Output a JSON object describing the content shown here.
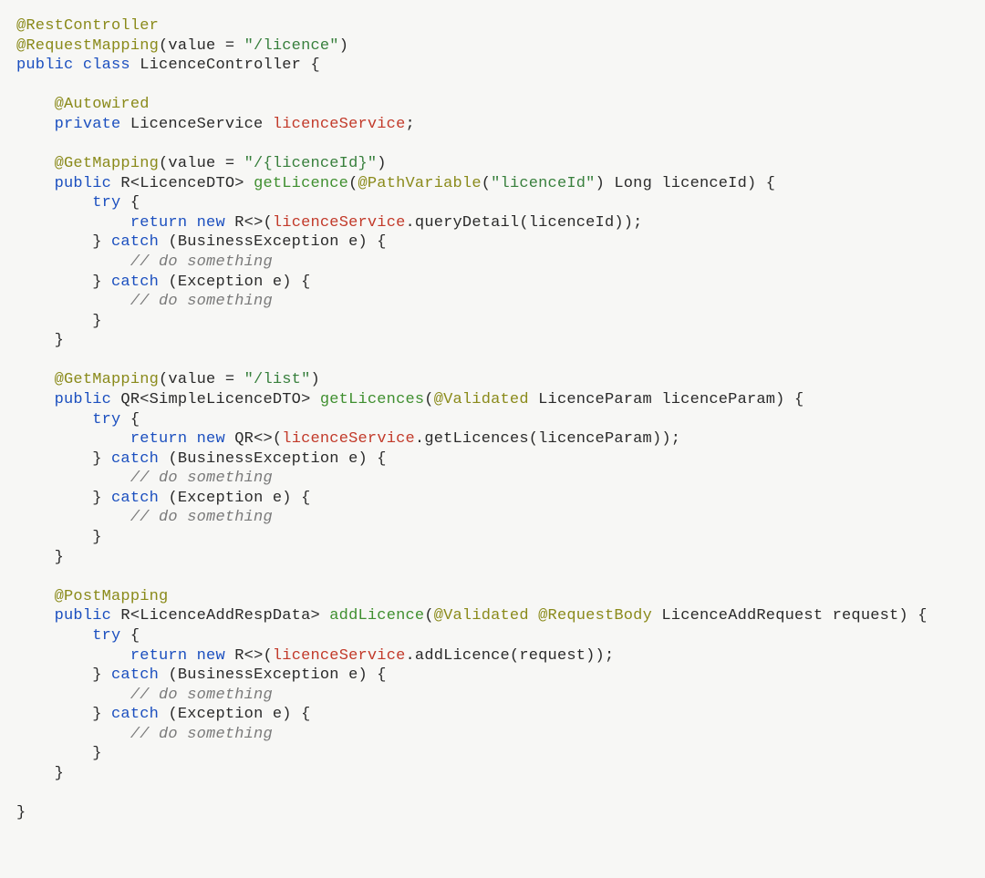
{
  "code": {
    "line01_anno": "@RestController",
    "line02_anno": "@RequestMapping",
    "line02_rest": "(value = ",
    "line02_str": "\"/licence\"",
    "line02_end": ")",
    "line03_kw1": "public",
    "line03_kw2": "class",
    "line03_rest": " LicenceController {",
    "line05_anno": "@Autowired",
    "line06_kw": "private",
    "line06_a": " LicenceService ",
    "line06_field": "licenceService",
    "line06_end": ";",
    "line08_anno": "@GetMapping",
    "line08_a": "(value = ",
    "line08_str": "\"/{licenceId}\"",
    "line08_end": ")",
    "line09_kw": "public",
    "line09_a": " R<LicenceDTO> ",
    "line09_meth": "getLicence",
    "line09_b": "(",
    "line09_anno": "@PathVariable",
    "line09_c": "(",
    "line09_str": "\"licenceId\"",
    "line09_d": ") Long licenceId) {",
    "line10_kw": "try",
    "line10_rest": " {",
    "line11_kw1": "return",
    "line11_kw2": "new",
    "line11_a": " R<>(",
    "line11_field": "licenceService",
    "line11_b": ".queryDetail(licenceId));",
    "line12_a": "} ",
    "line12_kw": "catch",
    "line12_b": " (BusinessException e) {",
    "line13_comm": "// do something",
    "line14_a": "} ",
    "line14_kw": "catch",
    "line14_b": " (Exception e) {",
    "line15_comm": "// do something",
    "line16": "}",
    "line17": "}",
    "line19_anno": "@GetMapping",
    "line19_a": "(value = ",
    "line19_str": "\"/list\"",
    "line19_end": ")",
    "line20_kw": "public",
    "line20_a": " QR<SimpleLicenceDTO> ",
    "line20_meth": "getLicences",
    "line20_b": "(",
    "line20_anno": "@Validated",
    "line20_c": " LicenceParam licenceParam) {",
    "line21_kw": "try",
    "line21_rest": " {",
    "line22_kw1": "return",
    "line22_kw2": "new",
    "line22_a": " QR<>(",
    "line22_field": "licenceService",
    "line22_b": ".getLicences(licenceParam));",
    "line23_a": "} ",
    "line23_kw": "catch",
    "line23_b": " (BusinessException e) {",
    "line24_comm": "// do something",
    "line25_a": "} ",
    "line25_kw": "catch",
    "line25_b": " (Exception e) {",
    "line26_comm": "// do something",
    "line27": "}",
    "line28": "}",
    "line30_anno": "@PostMapping",
    "line31_kw": "public",
    "line31_a": " R<LicenceAddRespData> ",
    "line31_meth": "addLicence",
    "line31_b": "(",
    "line31_anno1": "@Validated",
    "line31_sp": " ",
    "line31_anno2": "@RequestBody",
    "line31_c": " LicenceAddRequest request) {",
    "line32_kw": "try",
    "line32_rest": " {",
    "line33_kw1": "return",
    "line33_kw2": "new",
    "line33_a": " R<>(",
    "line33_field": "licenceService",
    "line33_b": ".addLicence(request));",
    "line34_a": "} ",
    "line34_kw": "catch",
    "line34_b": " (BusinessException e) {",
    "line35_comm": "// do something",
    "line36_a": "} ",
    "line36_kw": "catch",
    "line36_b": " (Exception e) {",
    "line37_comm": "// do something",
    "line38": "}",
    "line39": "}",
    "line41": "}"
  }
}
